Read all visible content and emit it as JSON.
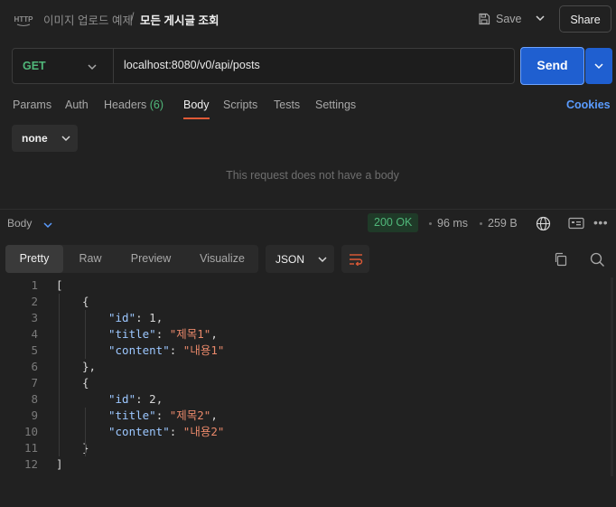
{
  "header": {
    "icon_label": "HTTP",
    "breadcrumb_parent": "이미지 업로드 예제",
    "breadcrumb_separator": "/",
    "breadcrumb_current": "모든 게시글 조회",
    "save_label": "Save",
    "share_label": "Share"
  },
  "request": {
    "method": "GET",
    "url": "localhost:8080/v0/api/posts",
    "send_label": "Send"
  },
  "tabs": {
    "params": "Params",
    "auth": "Auth",
    "headers": "Headers",
    "headers_count": "(6)",
    "body": "Body",
    "scripts": "Scripts",
    "tests": "Tests",
    "settings": "Settings",
    "cookies": "Cookies",
    "active": "Body"
  },
  "body_panel": {
    "body_type": "none",
    "empty_message": "This request does not have a body"
  },
  "response": {
    "section_label": "Body",
    "status": "200 OK",
    "time": "96 ms",
    "size": "259 B",
    "view_tabs": [
      "Pretty",
      "Raw",
      "Preview",
      "Visualize"
    ],
    "active_view": "Pretty",
    "format": "JSON",
    "code_lines": [
      {
        "n": "1",
        "indent": 0,
        "tokens": [
          [
            "punct",
            "["
          ]
        ]
      },
      {
        "n": "2",
        "indent": 1,
        "tokens": [
          [
            "punct",
            "{"
          ]
        ]
      },
      {
        "n": "3",
        "indent": 2,
        "tokens": [
          [
            "key",
            "\"id\""
          ],
          [
            "punct",
            ": "
          ],
          [
            "num",
            "1"
          ],
          [
            "punct",
            ","
          ]
        ]
      },
      {
        "n": "4",
        "indent": 2,
        "tokens": [
          [
            "key",
            "\"title\""
          ],
          [
            "punct",
            ": "
          ],
          [
            "str",
            "\"제목1\""
          ],
          [
            "punct",
            ","
          ]
        ]
      },
      {
        "n": "5",
        "indent": 2,
        "tokens": [
          [
            "key",
            "\"content\""
          ],
          [
            "punct",
            ": "
          ],
          [
            "str",
            "\"내용1\""
          ]
        ]
      },
      {
        "n": "6",
        "indent": 1,
        "tokens": [
          [
            "punct",
            "},"
          ]
        ]
      },
      {
        "n": "7",
        "indent": 1,
        "tokens": [
          [
            "punct",
            "{"
          ]
        ]
      },
      {
        "n": "8",
        "indent": 2,
        "tokens": [
          [
            "key",
            "\"id\""
          ],
          [
            "punct",
            ": "
          ],
          [
            "num",
            "2"
          ],
          [
            "punct",
            ","
          ]
        ]
      },
      {
        "n": "9",
        "indent": 2,
        "tokens": [
          [
            "key",
            "\"title\""
          ],
          [
            "punct",
            ": "
          ],
          [
            "str",
            "\"제목2\""
          ],
          [
            "punct",
            ","
          ]
        ]
      },
      {
        "n": "10",
        "indent": 2,
        "tokens": [
          [
            "key",
            "\"content\""
          ],
          [
            "punct",
            ": "
          ],
          [
            "str",
            "\"내용2\""
          ]
        ]
      },
      {
        "n": "11",
        "indent": 1,
        "tokens": [
          [
            "punct",
            "}"
          ]
        ]
      },
      {
        "n": "12",
        "indent": 0,
        "tokens": [
          [
            "punct",
            "]"
          ]
        ]
      }
    ]
  },
  "colors": {
    "accent_send": "#1f5fd0",
    "status_ok": "#50b87a",
    "active_tab_underline": "#e05a36",
    "link": "#5a9cff"
  },
  "icons": [
    "http-icon",
    "save-icon",
    "chevron-down-icon",
    "globe-icon",
    "save-response-icon",
    "more-icon",
    "wrap-icon",
    "copy-icon",
    "search-icon"
  ]
}
